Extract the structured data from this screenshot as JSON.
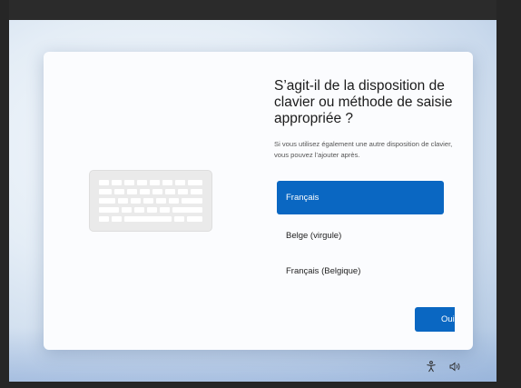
{
  "dialog": {
    "title": "S’agit-il de la disposition de clavier ou méthode de saisie appropriée ?",
    "subtitle": "Si vous utilisez également une autre disposition de clavier, vous pouvez l’ajouter après.",
    "options": [
      {
        "label": "Français",
        "selected": true
      },
      {
        "label": "Belge (virgule)",
        "selected": false
      },
      {
        "label": "Français (Belgique)",
        "selected": false
      }
    ],
    "next_label": "Oui"
  },
  "illustration": {
    "icon": "keyboard-icon"
  },
  "tray": {
    "icons": [
      "accessibility-icon",
      "volume-icon"
    ]
  },
  "colors": {
    "accent": "#0a67c2",
    "card": "#fbfcfe",
    "text": "#1b1b1b",
    "subtext": "#555555"
  }
}
